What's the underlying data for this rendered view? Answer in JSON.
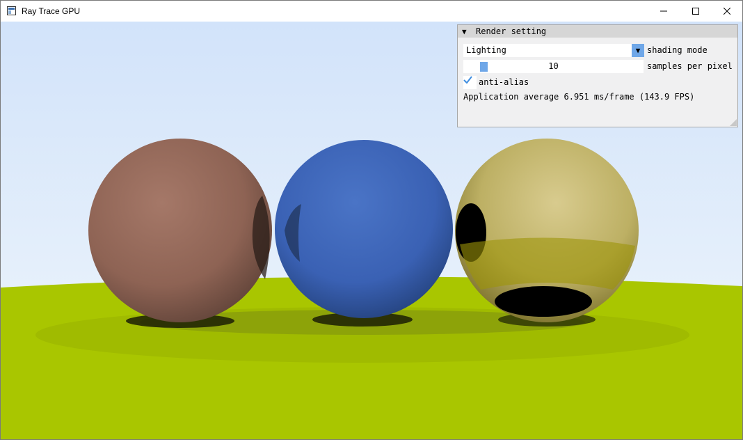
{
  "window": {
    "title": "Ray Trace GPU"
  },
  "panel": {
    "title": "Render setting",
    "shading": {
      "value": "Lighting",
      "label": "shading mode"
    },
    "samples": {
      "value": "10",
      "label": "samples per pixel"
    },
    "antialias": {
      "label": "anti-alias",
      "checked": true
    },
    "stats": "Application average 6.951 ms/frame (143.9 FPS)"
  },
  "colors": {
    "accent": "#6fa7e8",
    "sky": "#d8e8fb",
    "ground": "#a9c600",
    "sphere_left": "#94665a",
    "sphere_middle": "#3b63b8",
    "sphere_right": "#c8b874"
  }
}
